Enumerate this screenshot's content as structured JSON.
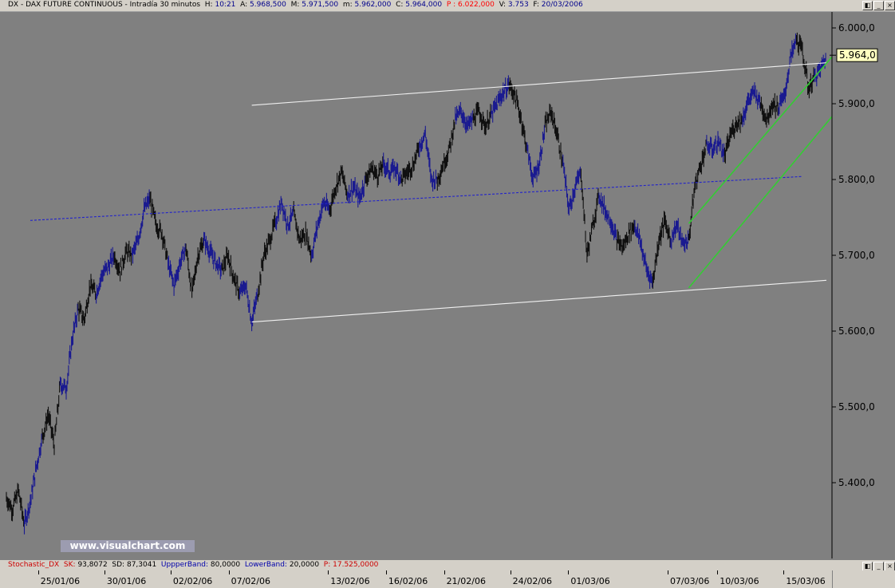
{
  "header": {
    "symbol": "DX",
    "instrument": "DAX FUTURE CONTINUOUS",
    "interval": "Intradía 30 minutos",
    "h_label": "H:",
    "h_value": "10:21",
    "a_label": "A:",
    "a_value": "5.968,500",
    "m_label": "M:",
    "m_value": "5.971,500",
    "lo_label": "m:",
    "lo_value": "5.962,000",
    "c_label": "C:",
    "c_value": "5.964,000",
    "p_label": "P :",
    "p_value": "6.022,000",
    "v_label": "V:",
    "v_value": "3.753",
    "f_label": "F:",
    "f_value": "20/03/2006"
  },
  "window": {
    "restore": "◧",
    "minimize": "_",
    "close": "×"
  },
  "watermark": "www.visualchart.com",
  "stochastic": {
    "name": "Stochastic_DX",
    "sk_label": "SK:",
    "sk_value": "93,8072",
    "sd_label": "SD:",
    "sd_value": "87,3041",
    "upper_label": "UppperBand:",
    "upper_value": "80,0000",
    "lower_label": "LowerBand:",
    "lower_value": "20,0000",
    "p_label": "P:",
    "p_value": "17.525,0000"
  },
  "colors": {
    "background": "#808080",
    "bar_dark": "#101010",
    "bar_blue": "#1a1a90",
    "channel_white": "#f0f0f0",
    "channel_green": "#33cc33",
    "midline_blue": "#2222cc",
    "last_price_box": "#ffffc0"
  },
  "chart_data": {
    "type": "line",
    "title": "DX - DAX FUTURE CONTINUOUS - Intradía 30 minutos",
    "xlabel": "",
    "ylabel": "",
    "ylim": [
      5325,
      6020
    ],
    "y_ticks": [
      5400,
      5500,
      5600,
      5700,
      5800,
      5900,
      6000
    ],
    "y_tick_labels": [
      "5.400,0",
      "5.500,0",
      "5.600,0",
      "5.700,0",
      "5.800,0",
      "5.900,0",
      "6.000,0"
    ],
    "x_tick_labels": [
      "25/01/06",
      "30/01/06",
      "02/02/06",
      "07/02/06",
      "13/02/06",
      "16/02/06",
      "21/02/06",
      "24/02/06",
      "01/03/06",
      "07/03/06",
      "10/03/06",
      "15/03/06"
    ],
    "last_price_label": "5.964,0",
    "last_price": 5964,
    "series": [
      {
        "values": [
          5380,
          5365,
          5390,
          5345,
          5375,
          5420,
          5460,
          5490,
          5450,
          5530,
          5525,
          5590,
          5630,
          5615,
          5660,
          5650,
          5675,
          5685,
          5700,
          5680,
          5705,
          5700,
          5720,
          5760,
          5775,
          5740,
          5730,
          5690,
          5660,
          5690,
          5710,
          5650,
          5700,
          5720,
          5705,
          5690,
          5680,
          5700,
          5670,
          5650,
          5660,
          5612,
          5650,
          5700,
          5720,
          5745,
          5770,
          5740,
          5755,
          5720,
          5730,
          5700,
          5740,
          5770,
          5760,
          5790,
          5810,
          5780,
          5790,
          5775,
          5800,
          5815,
          5805,
          5820,
          5810,
          5815,
          5800,
          5810,
          5820,
          5845,
          5860,
          5800,
          5800,
          5820,
          5840,
          5880,
          5890,
          5870,
          5880,
          5890,
          5870,
          5885,
          5900,
          5915,
          5925,
          5910,
          5880,
          5840,
          5800,
          5820,
          5870,
          5890,
          5860,
          5820,
          5760,
          5790,
          5810,
          5700,
          5740,
          5780,
          5760,
          5745,
          5720,
          5710,
          5730,
          5740,
          5715,
          5680,
          5665,
          5720,
          5745,
          5720,
          5740,
          5715,
          5720,
          5790,
          5820,
          5845,
          5840,
          5850,
          5830,
          5860,
          5875,
          5880,
          5905,
          5915,
          5900,
          5880,
          5900,
          5895,
          5910,
          5960,
          5985,
          5970,
          5920,
          5935,
          5945,
          5964
        ]
      }
    ],
    "annotations": [
      {
        "type": "trendline",
        "label": "",
        "x": [
          41,
          137
        ],
        "y": [
          5612,
          5667
        ],
        "color": "white"
      },
      {
        "type": "trendline",
        "label": "",
        "x": [
          41,
          137
        ],
        "y": [
          5898,
          5954
        ],
        "color": "white"
      },
      {
        "type": "trendline",
        "label": "",
        "x": [
          4,
          133
        ],
        "y": [
          5746,
          5804
        ],
        "color": "blue",
        "style": "dashed"
      },
      {
        "type": "trendline",
        "label": "",
        "x": [
          114,
          141
        ],
        "y": [
          5742,
          5990
        ],
        "color": "green"
      },
      {
        "type": "trendline",
        "label": "",
        "x": [
          114,
          141
        ],
        "y": [
          5657,
          5912
        ],
        "color": "green"
      }
    ]
  }
}
